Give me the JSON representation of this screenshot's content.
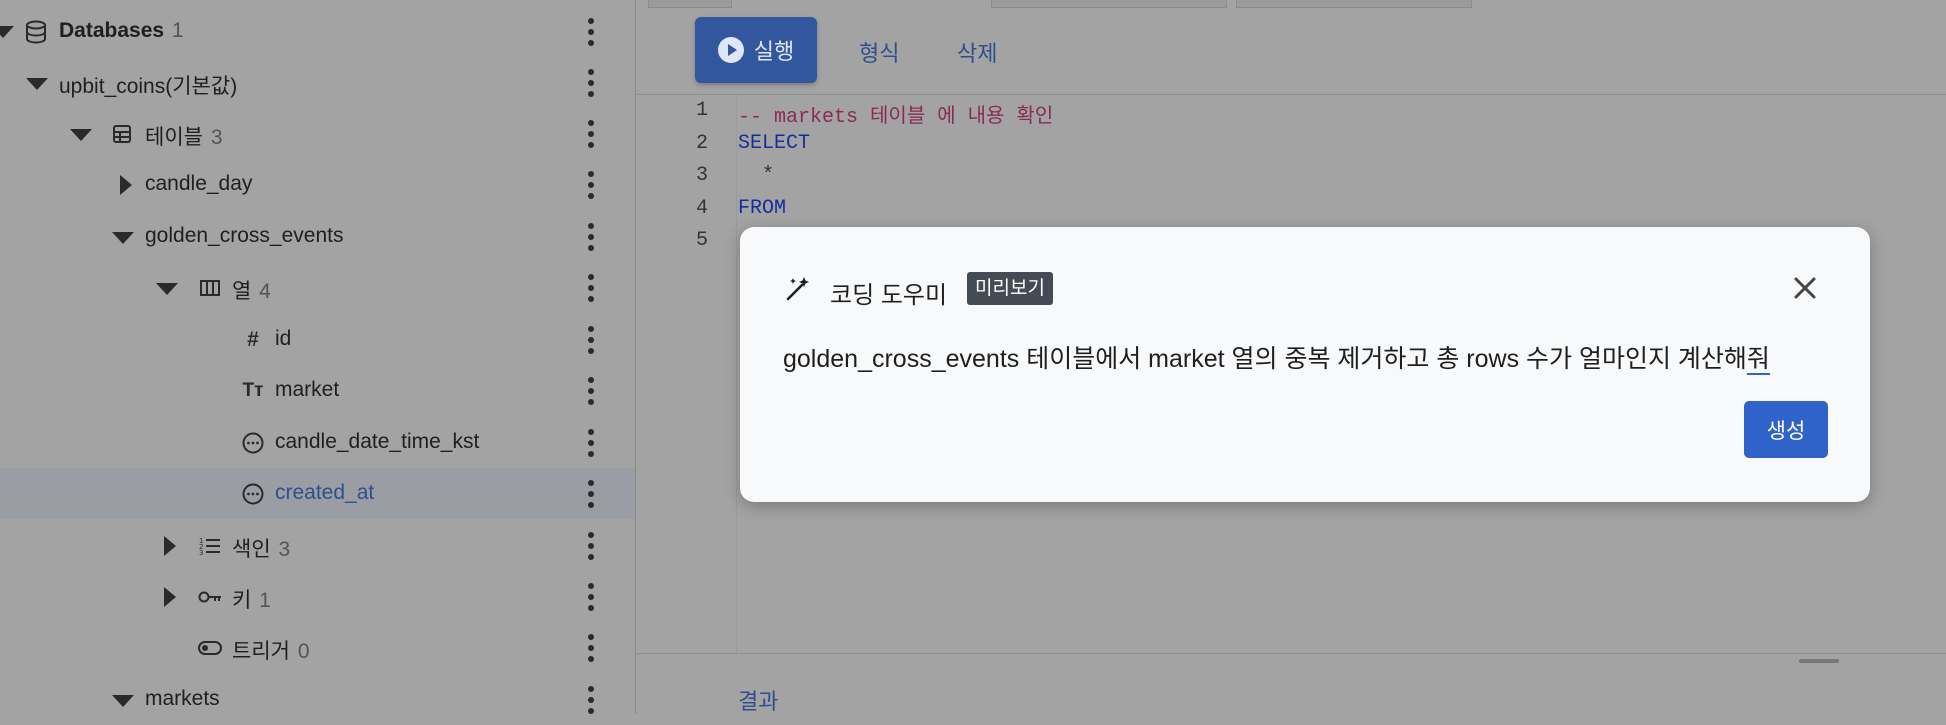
{
  "sidebar": {
    "databases": {
      "label": "Databases",
      "count": "1"
    },
    "db": {
      "label": "upbit_coins(기본값)"
    },
    "tables": {
      "label": "테이블",
      "count": "3"
    },
    "candle_day": {
      "label": "candle_day"
    },
    "golden_cross_events": {
      "label": "golden_cross_events"
    },
    "columns": {
      "label": "열",
      "count": "4"
    },
    "col_id": {
      "label": "id",
      "icon": "#"
    },
    "col_market": {
      "label": "market",
      "icon": "Tт"
    },
    "col_candle": {
      "label": "candle_date_time_kst"
    },
    "col_created": {
      "label": "created_at"
    },
    "indexes": {
      "label": "색인",
      "count": "3"
    },
    "keys": {
      "label": "키",
      "count": "1"
    },
    "triggers": {
      "label": "트리거",
      "count": "0"
    },
    "markets": {
      "label": "markets"
    }
  },
  "toolbar": {
    "run_label": "실행",
    "format_label": "형식",
    "delete_label": "삭제"
  },
  "editor": {
    "line_numbers": [
      "1",
      "2",
      "3",
      "4",
      "5"
    ],
    "lines": [
      "-- markets 테이블 에 내용 확인",
      "SELECT",
      "  *",
      "FROM",
      ""
    ]
  },
  "results": {
    "label": "결과"
  },
  "dialog": {
    "title": "코딩 도우미",
    "badge": "미리보기",
    "prompt_main": "golden_cross_events 테이블에서 market 열의 중복 제거하고 총 rows 수가 얼마인지 계산해",
    "prompt_tail": "줘",
    "generate_label": "생성"
  },
  "colors": {
    "accent": "#2f63c9",
    "run_button": "#33579f",
    "selected_link": "#2f4f8c"
  }
}
